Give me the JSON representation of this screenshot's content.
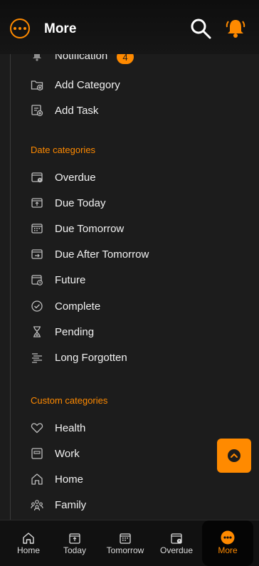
{
  "header": {
    "title": "More"
  },
  "menu": [
    {
      "label": "Notification",
      "badge": "4",
      "icon": "bell-icon"
    },
    {
      "label": "Add Category",
      "icon": "folder-plus-icon"
    },
    {
      "label": "Add Task",
      "icon": "task-add-icon"
    }
  ],
  "date_section": "Date categories",
  "date_categories": [
    {
      "label": "Overdue",
      "icon": "calendar-alert-icon"
    },
    {
      "label": "Due Today",
      "icon": "calendar-today-icon"
    },
    {
      "label": "Due Tomorrow",
      "icon": "calendar-grid-icon"
    },
    {
      "label": "Due After Tomorrow",
      "icon": "calendar-arrow-icon"
    },
    {
      "label": "Future",
      "icon": "calendar-clock-icon"
    },
    {
      "label": "Complete",
      "icon": "check-circle-icon"
    },
    {
      "label": "Pending",
      "icon": "hourglass-icon"
    },
    {
      "label": "Long Forgotten",
      "icon": "lines-icon"
    }
  ],
  "custom_section": "Custom categories",
  "custom_categories": [
    {
      "label": "Health",
      "icon": "heart-icon"
    },
    {
      "label": "Work",
      "icon": "briefcase-icon"
    },
    {
      "label": "Home",
      "icon": "home-icon"
    },
    {
      "label": "Family",
      "icon": "family-icon"
    }
  ],
  "nav": [
    {
      "label": "Home",
      "icon": "home-icon"
    },
    {
      "label": "Today",
      "icon": "calendar-today-icon"
    },
    {
      "label": "Tomorrow",
      "icon": "calendar-grid-icon"
    },
    {
      "label": "Overdue",
      "icon": "calendar-alert-icon"
    },
    {
      "label": "More",
      "icon": "more-icon",
      "active": true
    }
  ],
  "colors": {
    "accent": "#ff8a00",
    "background": "#1c1c1c"
  }
}
